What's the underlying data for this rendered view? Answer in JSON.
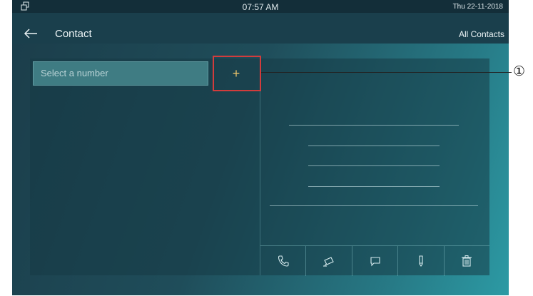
{
  "status_bar": {
    "time": "07:57 AM",
    "date": "Thu   22-11-2018",
    "icon": "multi-window-icon"
  },
  "header": {
    "title": "Contact",
    "filter_label": "All Contacts",
    "back_icon": "back-arrow-icon"
  },
  "search": {
    "placeholder": "Select a number"
  },
  "add_button": {
    "label": "+"
  },
  "actions": [
    "phone-icon",
    "camera-icon",
    "message-icon",
    "edit-icon",
    "delete-icon"
  ],
  "annotation": {
    "marker": "①",
    "color": "#d23c3c"
  },
  "colors": {
    "accent": "#e4c06a",
    "panel": "#1a3f4c"
  }
}
